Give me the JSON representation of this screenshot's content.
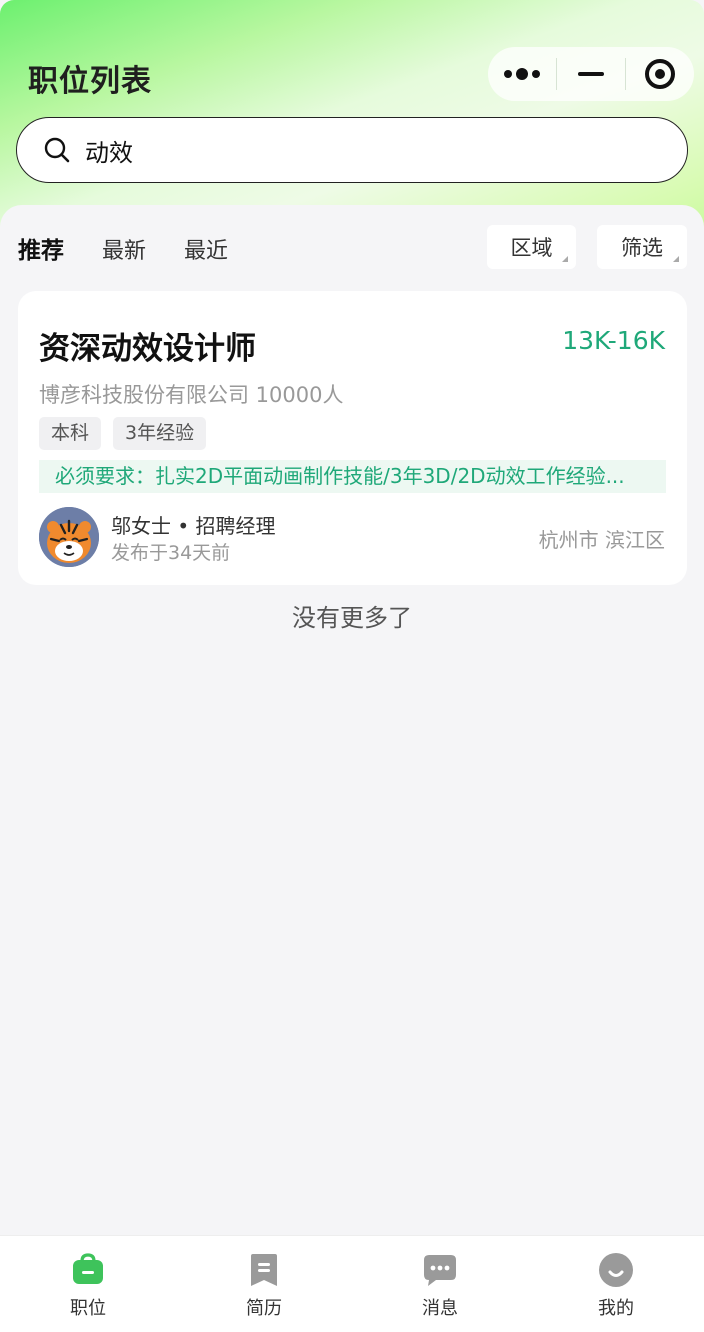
{
  "header": {
    "title": "职位列表",
    "capsule": {
      "more_icon": "more-dots-icon",
      "minimize_icon": "minimize-icon",
      "close_icon": "target-icon"
    }
  },
  "search": {
    "value": "动效",
    "placeholder": "",
    "icon": "search-icon"
  },
  "tabs": [
    {
      "label": "推荐",
      "active": true
    },
    {
      "label": "最新",
      "active": false
    },
    {
      "label": "最近",
      "active": false
    }
  ],
  "filters": {
    "area_label": "区域",
    "filter_label": "筛选"
  },
  "jobs": [
    {
      "title": "资深动效设计师",
      "salary": "13K-16K",
      "company": "博彦科技股份有限公司 10000人",
      "tags": [
        "本科",
        "3年经验"
      ],
      "requirement": "必须要求：扎实2D平面动画制作技能/3年3D/2D动效工作经验...",
      "recruiter": "邬女士 • 招聘经理",
      "posted": "发布于34天前",
      "location": "杭州市 滨江区"
    }
  ],
  "list_end_text": "没有更多了",
  "tabbar": [
    {
      "label": "职位",
      "icon": "briefcase-icon",
      "active": true
    },
    {
      "label": "简历",
      "icon": "resume-icon",
      "active": false
    },
    {
      "label": "消息",
      "icon": "message-icon",
      "active": false
    },
    {
      "label": "我的",
      "icon": "profile-icon",
      "active": false
    }
  ],
  "colors": {
    "accent": "#3ec35b",
    "salary": "#1fa879",
    "inactive_icon": "#9a9a9a"
  }
}
